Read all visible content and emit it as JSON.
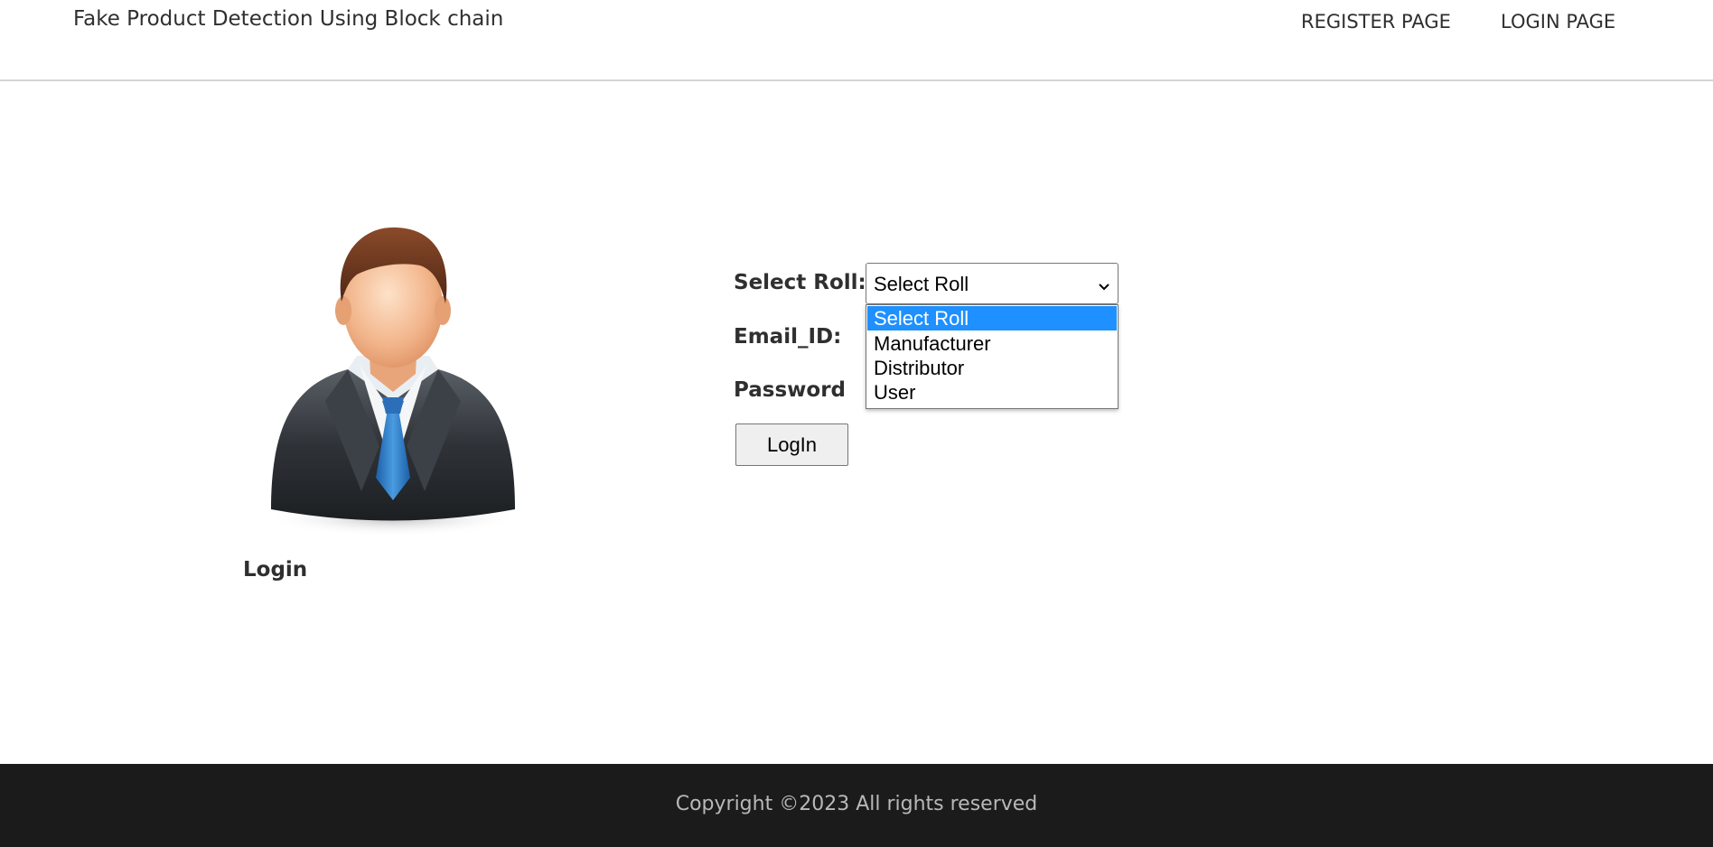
{
  "header": {
    "brand_title": "Fake Product Detection Using Block chain",
    "nav": {
      "register_label": "REGISTER PAGE",
      "login_label": "LOGIN PAGE"
    }
  },
  "profile": {
    "avatar_icon": "businessman-avatar-icon",
    "caption": "Login"
  },
  "form": {
    "roll_label": "Select Roll:",
    "email_label": "Email_ID:",
    "password_label": "Password",
    "roll_select": {
      "current_value": "Select Roll",
      "options": [
        "Select Roll",
        "Manufacturer",
        "Distributor",
        "User"
      ],
      "highlighted_option": "Select Roll"
    },
    "submit_label": "LogIn"
  },
  "footer": {
    "copyright": "Copyright ©2023 All rights reserved"
  },
  "colors": {
    "footer_bg": "#1b1b1b",
    "highlight": "#1e90ff",
    "text": "#2f2f2f"
  }
}
